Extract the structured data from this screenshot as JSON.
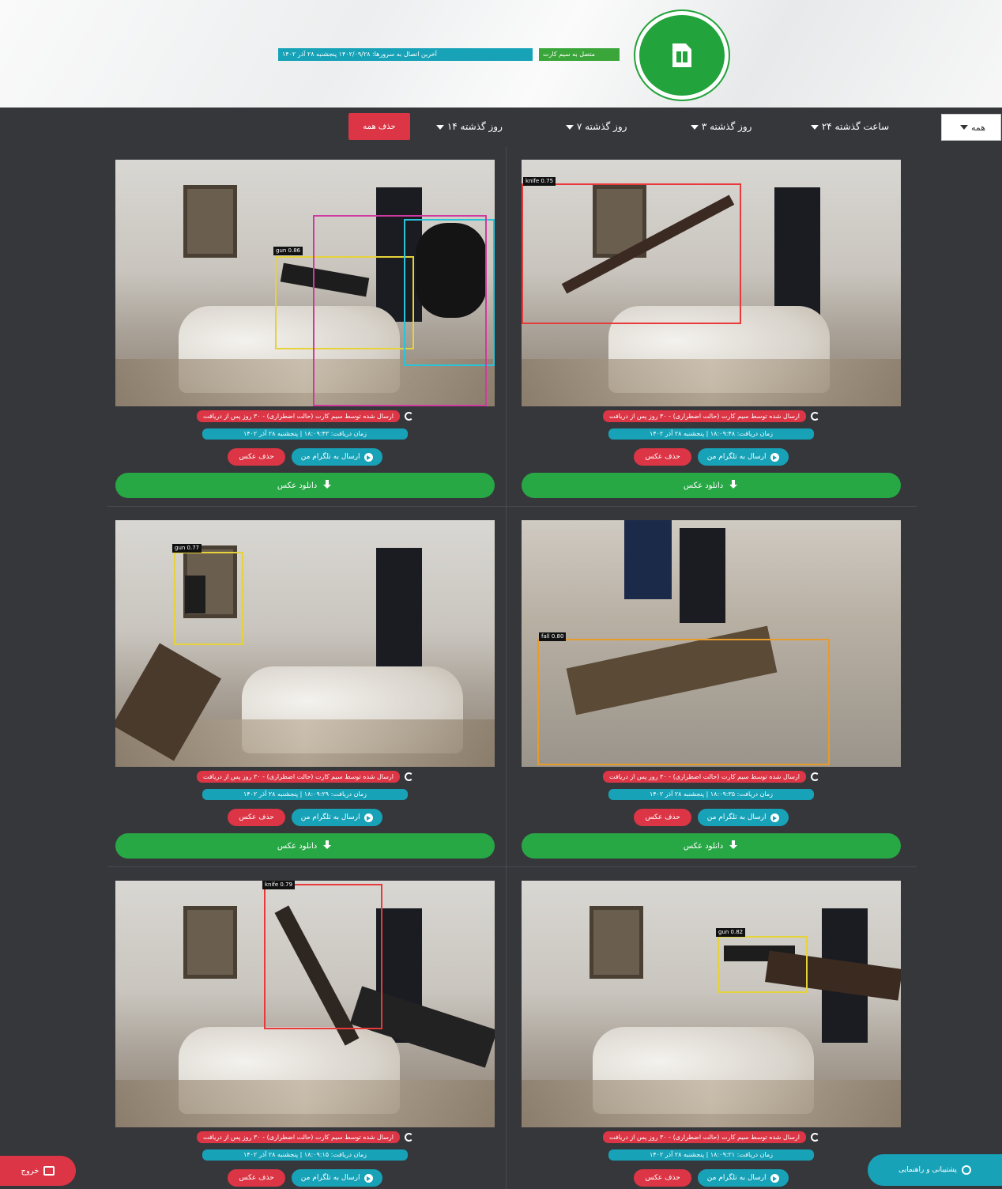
{
  "header": {
    "sim_status": "متصل به سیم کارت",
    "last_connection": "آخرین اتصال به سرورها: ۱۴۰۲/۰۹/۲۸ پنجشنبه ۲۸ آذر ۱۴۰۲"
  },
  "filters": [
    {
      "label": "همه"
    },
    {
      "label": "۲۴ ساعت گذشته"
    },
    {
      "label": "۳ روز گذشته"
    },
    {
      "label": "۷ روز گذشته"
    },
    {
      "label": "۱۴ روز گذشته"
    }
  ],
  "delete_all_label": "حذف همه",
  "card_texts": {
    "sentence": "ارسال شده توسط سیم کارت (حالت اضطراری) - ۳۰ روز پس از دریافت",
    "delete_label": "حذف عکس",
    "send_label": "ارسال به تلگرام من",
    "download_label": "دانلود عکس"
  },
  "cards": [
    {
      "time": "زمان دریافت: ۱۸:۰۹:۴۸ | پنجشنبه ۲۸ آذر ۱۴۰۲",
      "detection": "knife 0.75"
    },
    {
      "time": "زمان دریافت: ۱۸:۰۹:۴۳ | پنجشنبه ۲۸ آذر ۱۴۰۲",
      "detection": "gun 0.86"
    },
    {
      "time": "زمان دریافت: ۱۸:۰۹:۳۵ | پنجشنبه ۲۸ آذر ۱۴۰۲",
      "detection": "fall 0.80"
    },
    {
      "time": "زمان دریافت: ۱۸:۰۹:۲۹ | پنجشنبه ۲۸ آذر ۱۴۰۲",
      "detection": "gun 0.77"
    },
    {
      "time": "زمان دریافت: ۱۸:۰۹:۲۱ | پنجشنبه ۲۸ آذر ۱۴۰۲",
      "detection": "gun 0.82"
    },
    {
      "time": "زمان دریافت: ۱۸:۰۹:۱۵ | پنجشنبه ۲۸ آذر ۱۴۰۲",
      "detection": "knife 0.79"
    }
  ],
  "floating": {
    "exit_label": "خروج",
    "support_label": "پشتیبانی و راهنمایی"
  },
  "colors": {
    "brand_green": "#23a33b",
    "danger": "#dc3545",
    "info": "#17a2b8",
    "dark_bg": "#36373b"
  }
}
